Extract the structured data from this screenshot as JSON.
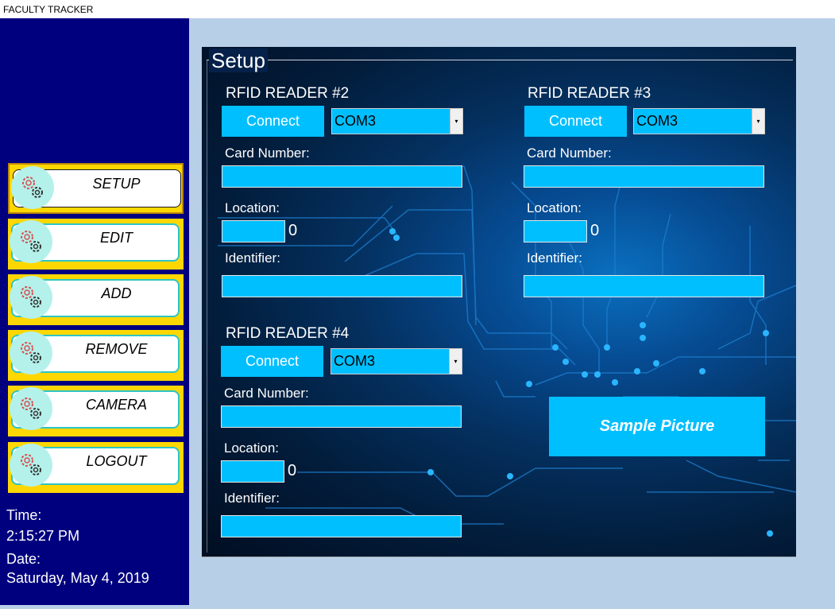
{
  "window": {
    "title": "FACULTY TRACKER"
  },
  "sidebar": {
    "items": [
      {
        "label": "SETUP"
      },
      {
        "label": "EDIT"
      },
      {
        "label": "ADD"
      },
      {
        "label": "REMOVE"
      },
      {
        "label": "CAMERA"
      },
      {
        "label": "LOGOUT"
      }
    ],
    "time_label": "Time:",
    "time_value": "2:15:27 PM",
    "date_label": "Date:",
    "date_value": "Saturday, May 4, 2019"
  },
  "setup": {
    "title": "Setup",
    "readers": [
      {
        "title": "RFID READER #2",
        "connect_label": "Connect",
        "port": "COM3",
        "card_label": "Card Number:",
        "card_value": "",
        "location_label": "Location:",
        "location_value": "",
        "location_count": "0",
        "identifier_label": "Identifier:",
        "identifier_value": ""
      },
      {
        "title": "RFID READER #3",
        "connect_label": "Connect",
        "port": "COM3",
        "card_label": "Card Number:",
        "card_value": "",
        "location_label": "Location:",
        "location_value": "",
        "location_count": "0",
        "identifier_label": "Identifier:",
        "identifier_value": ""
      },
      {
        "title": "RFID READER #4",
        "connect_label": "Connect",
        "port": "COM3",
        "card_label": "Card Number:",
        "card_value": "",
        "location_label": "Location:",
        "location_value": "",
        "location_count": "0",
        "identifier_label": "Identifier:",
        "identifier_value": ""
      }
    ],
    "sample_picture_label": "Sample Picture"
  },
  "icons": {
    "nav": "gears-icon",
    "dropdown": "dropdown-arrow-icon"
  },
  "colors": {
    "sidebar_bg": "#00007f",
    "nav_bg": "#ffd700",
    "accent": "#00bfff",
    "page_bg": "#b8cfe8"
  }
}
